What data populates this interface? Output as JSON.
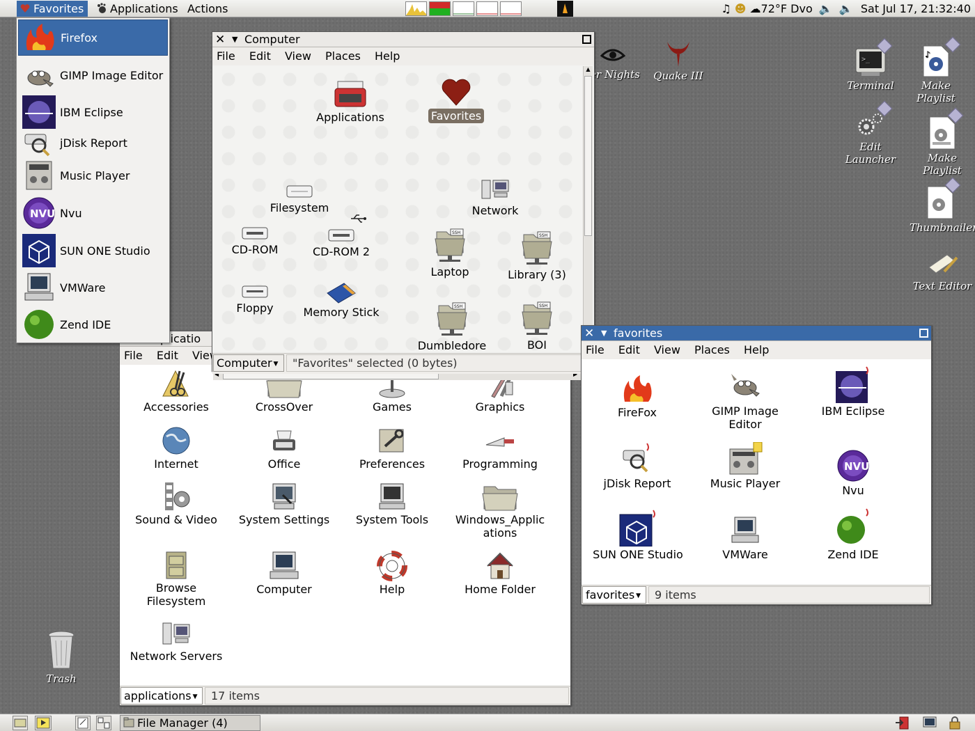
{
  "top_panel": {
    "favorites": "Favorites",
    "applications": "Applications",
    "actions": "Actions",
    "weather": "72°F Dvo",
    "clock": "Sat Jul 17, 21:32:40"
  },
  "favorites_menu": {
    "items": [
      {
        "label": "Firefox",
        "icon": "firefox-icon"
      },
      {
        "label": "GIMP Image Editor",
        "icon": "gimp-icon"
      },
      {
        "label": "IBM Eclipse",
        "icon": "eclipse-icon"
      },
      {
        "label": "jDisk Report",
        "icon": "jdisk-icon"
      },
      {
        "label": "Music Player",
        "icon": "music-player-icon"
      },
      {
        "label": "Nvu",
        "icon": "nvu-icon"
      },
      {
        "label": "SUN ONE Studio",
        "icon": "sun-studio-icon"
      },
      {
        "label": "VMWare",
        "icon": "vmware-icon"
      },
      {
        "label": "Zend IDE",
        "icon": "zend-icon"
      }
    ]
  },
  "computer_window": {
    "title": "Computer",
    "menus": [
      "File",
      "Edit",
      "View",
      "Places",
      "Help"
    ],
    "items": [
      {
        "label": "Applications"
      },
      {
        "label": "Favorites"
      },
      {
        "label": "Filesystem"
      },
      {
        "label": "Network"
      },
      {
        "label": "CD-ROM"
      },
      {
        "label": "CD-ROM 2"
      },
      {
        "label": "Laptop"
      },
      {
        "label": "Library (3)"
      },
      {
        "label": "Floppy"
      },
      {
        "label": "Memory Stick"
      },
      {
        "label": "Dumbledore"
      },
      {
        "label": "BOI"
      }
    ],
    "location": "Computer",
    "status": "\"Favorites\" selected (0 bytes)"
  },
  "applications_window": {
    "title_partial": "plicatio",
    "menus": [
      "File",
      "Edit",
      "View"
    ],
    "items": [
      {
        "label": "Accessories"
      },
      {
        "label": "CrossOver"
      },
      {
        "label": "Games"
      },
      {
        "label": "Graphics"
      },
      {
        "label": "Internet"
      },
      {
        "label": "Office"
      },
      {
        "label": "Preferences"
      },
      {
        "label": "Programming"
      },
      {
        "label": "Sound & Video"
      },
      {
        "label": "System Settings"
      },
      {
        "label": "System Tools"
      },
      {
        "label": "Windows_Applic ations"
      },
      {
        "label": "Browse Filesystem"
      },
      {
        "label": "Computer"
      },
      {
        "label": "Help"
      },
      {
        "label": "Home Folder"
      },
      {
        "label": "Network Servers"
      }
    ],
    "location": "applications",
    "status": "17 items"
  },
  "favorites_window": {
    "title": "favorites",
    "menus": [
      "File",
      "Edit",
      "View",
      "Places",
      "Help"
    ],
    "items": [
      {
        "label": "FireFox"
      },
      {
        "label": "GIMP Image Editor"
      },
      {
        "label": "IBM Eclipse"
      },
      {
        "label": "jDisk Report"
      },
      {
        "label": "Music Player"
      },
      {
        "label": "Nvu"
      },
      {
        "label": "SUN ONE Studio"
      },
      {
        "label": "VMWare"
      },
      {
        "label": "Zend IDE"
      }
    ],
    "location": "favorites",
    "status": "9 items"
  },
  "desktop": {
    "icons": [
      {
        "label": "ter Nights"
      },
      {
        "label": "Quake III"
      },
      {
        "label": "Terminal"
      },
      {
        "label": "Make Playlist"
      },
      {
        "label": "Edit Launcher"
      },
      {
        "label": "Make Playlist"
      },
      {
        "label": "Thumbnailer"
      },
      {
        "label": "Text Editor"
      },
      {
        "label": "Trash"
      }
    ]
  },
  "bottom_panel": {
    "task": "File Manager (4)"
  },
  "colors": {
    "selection": "#3a6aa8",
    "desktop": "#6e6e6e",
    "favorite_selected": "#7a6f62"
  }
}
